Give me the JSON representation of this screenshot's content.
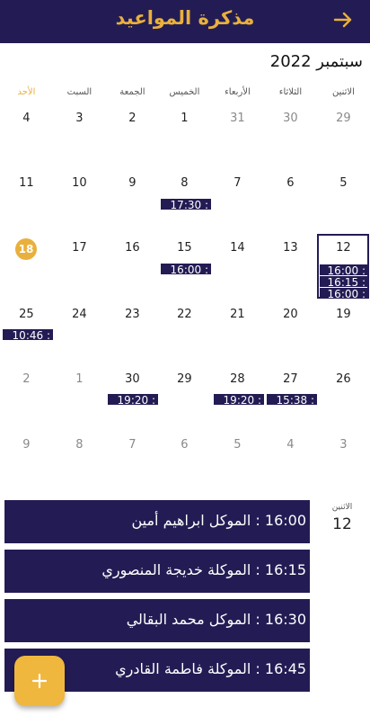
{
  "header": {
    "title": "مذكرة المواعيد",
    "back_icon": "arrow-right-icon"
  },
  "calendar": {
    "month_title": "سبتمبر 2022",
    "weekdays": [
      "الاثنين",
      "الثلاثاء",
      "الأربعاء",
      "الخميس",
      "الجمعة",
      "السبت",
      "الأحد"
    ],
    "weeks": [
      [
        "29",
        "30",
        "31",
        "1",
        "2",
        "3",
        "4"
      ],
      [
        "5",
        "6",
        "7",
        "8",
        "9",
        "10",
        "11"
      ],
      [
        "12",
        "13",
        "14",
        "15",
        "16",
        "17",
        "18"
      ],
      [
        "19",
        "20",
        "21",
        "22",
        "23",
        "24",
        "25"
      ],
      [
        "26",
        "27",
        "28",
        "29",
        "30",
        "1",
        "2"
      ],
      [
        "3",
        "4",
        "5",
        "6",
        "7",
        "8",
        "9"
      ]
    ],
    "today": "18",
    "selected": "12"
  },
  "events": {
    "sep8": "17:30 :",
    "sep12_a": "16:00 :",
    "sep12_b": "16:15 :",
    "sep12_c": "16:00 :",
    "sep15": "16:00 :",
    "sep25": "10:46 :",
    "sep27": "15:38 :",
    "sep28": "19:20 :",
    "sep30": "19:20 :"
  },
  "day_panel": {
    "weekday": "الاثنين",
    "day": "12",
    "appointments": [
      {
        "time": "16:00",
        "text": "16:00 : الموكل ابراهيم أمين"
      },
      {
        "time": "16:15",
        "text": "16:15 : الموكلة خديجة المنصوري"
      },
      {
        "time": "16:30",
        "text": "16:30 : الموكل محمد البقالي"
      },
      {
        "time": "16:45",
        "text": "16:45 : الموكلة فاطمة القادري"
      }
    ]
  },
  "fab": {
    "label": "+",
    "icon": "plus-icon"
  },
  "colors": {
    "primary": "#231c54",
    "accent": "#e9b03d",
    "fab": "#f0b73e"
  }
}
